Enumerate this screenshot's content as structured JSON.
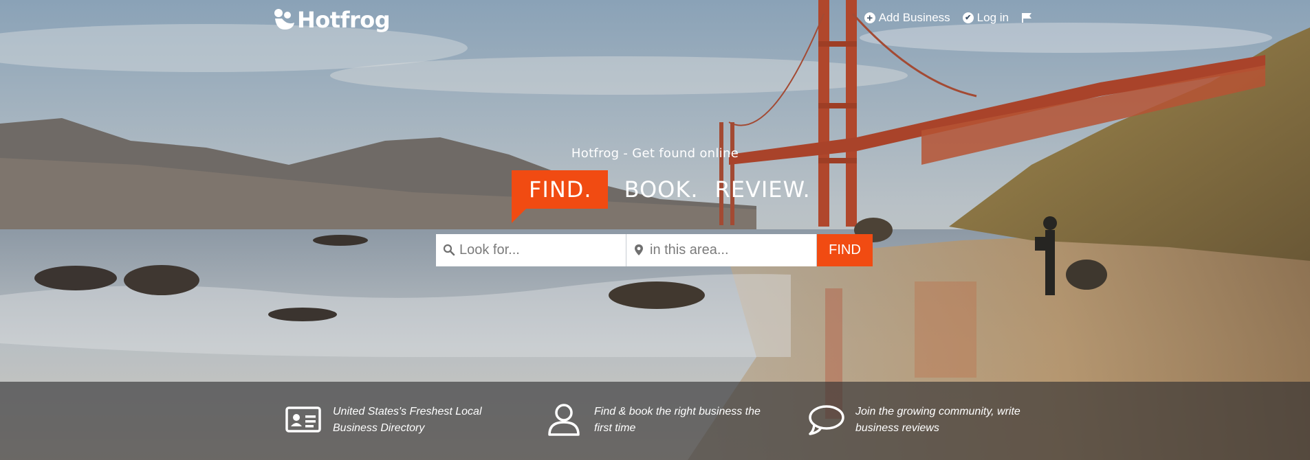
{
  "brand": {
    "name": "Hotfrog"
  },
  "nav": {
    "add_business": "Add Business",
    "login": "Log in",
    "flag_icon": "flag-icon"
  },
  "hero": {
    "tagline": "Hotfrog - Get found online",
    "headline": [
      "FIND.",
      "BOOK.",
      "REVIEW."
    ],
    "background": "golden-gate-bridge-beach-photo"
  },
  "search": {
    "what_placeholder": "Look for...",
    "where_placeholder": "in this area...",
    "button": "FIND"
  },
  "features": [
    {
      "icon": "id-card-icon",
      "text": "United States's Freshest Local Business Directory"
    },
    {
      "icon": "user-icon",
      "text": "Find & book the right business the first time"
    },
    {
      "icon": "speech-bubble-icon",
      "text": "Join the growing community, write business reviews"
    }
  ],
  "colors": {
    "accent": "#f14b12",
    "strip": "#2d2d30"
  }
}
